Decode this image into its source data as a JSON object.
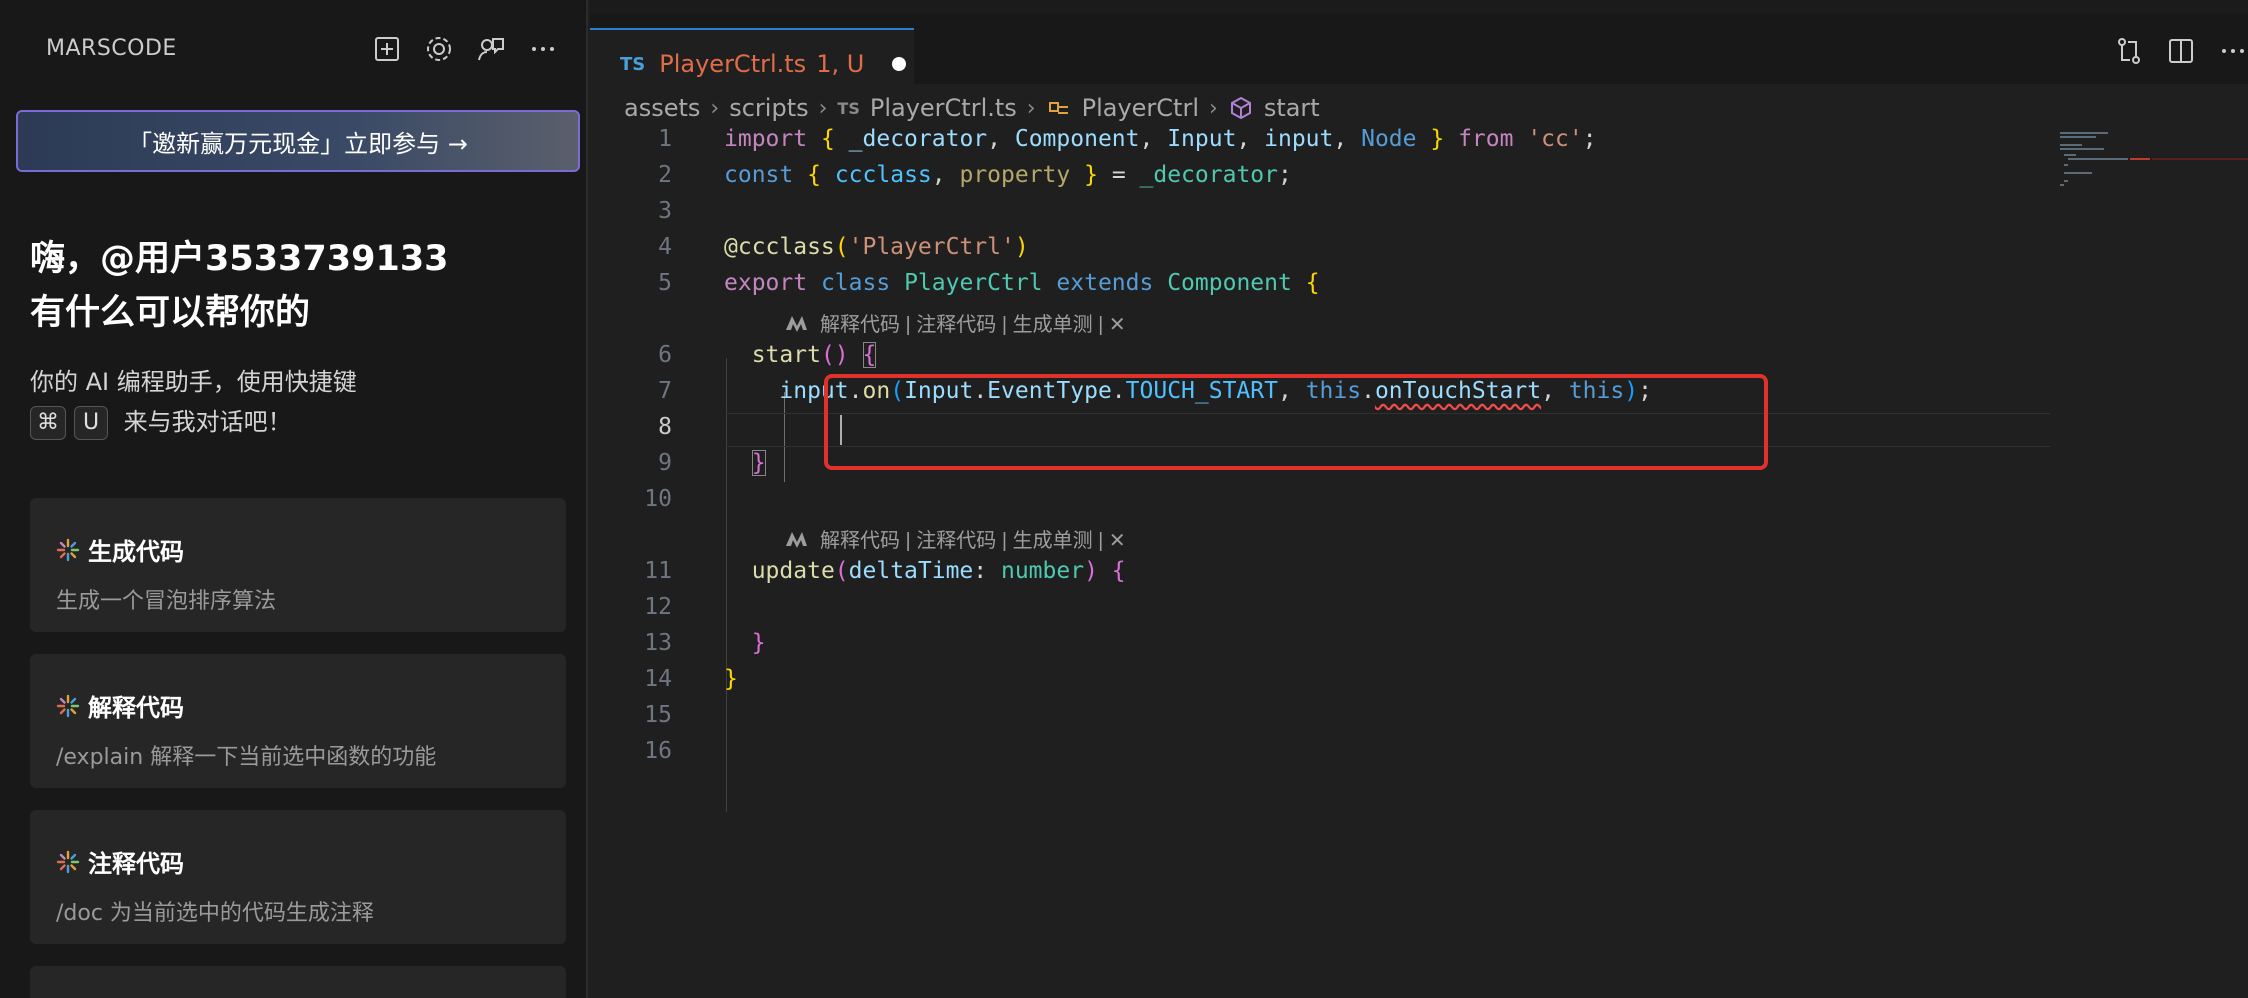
{
  "sidebar": {
    "title": "MARSCODE",
    "icons": [
      "new-chat-icon",
      "gear-icon",
      "feedback-icon",
      "more-icon"
    ],
    "promo": "「邀新赢万元现金」立即参与 →",
    "greeting_line1": "嗨，@用户3533739133",
    "greeting_line2": "有什么可以帮你的",
    "intro_line1": "你的 AI 编程助手，使用快捷键",
    "shortcut_key1": "⌘",
    "shortcut_key2": "U",
    "intro_line2": "来与我对话吧！",
    "cards": [
      {
        "title": "生成代码",
        "desc": "生成一个冒泡排序算法"
      },
      {
        "title": "解释代码",
        "desc": "/explain 解释一下当前选中函数的功能"
      },
      {
        "title": "注释代码",
        "desc": "/doc 为当前选中的代码生成注释"
      }
    ]
  },
  "editor": {
    "tab": {
      "lang": "TS",
      "filename": "PlayerCtrl.ts",
      "status": "1, U"
    },
    "breadcrumb": {
      "p1": "assets",
      "p2": "scripts",
      "p3_lang": "TS",
      "p3": "PlayerCtrl.ts",
      "p4": "PlayerCtrl",
      "p5": "start"
    },
    "codelens": "解释代码 | 注释代码 | 生成单测 | ✕",
    "line_numbers": [
      "1",
      "2",
      "3",
      "4",
      "5",
      "6",
      "7",
      "8",
      "9",
      "10",
      "11",
      "12",
      "13",
      "14",
      "15",
      "16"
    ],
    "colors": {
      "accent": "#2a7fd4",
      "highlight": "#e0322b",
      "modified": "#e06c4a"
    }
  }
}
